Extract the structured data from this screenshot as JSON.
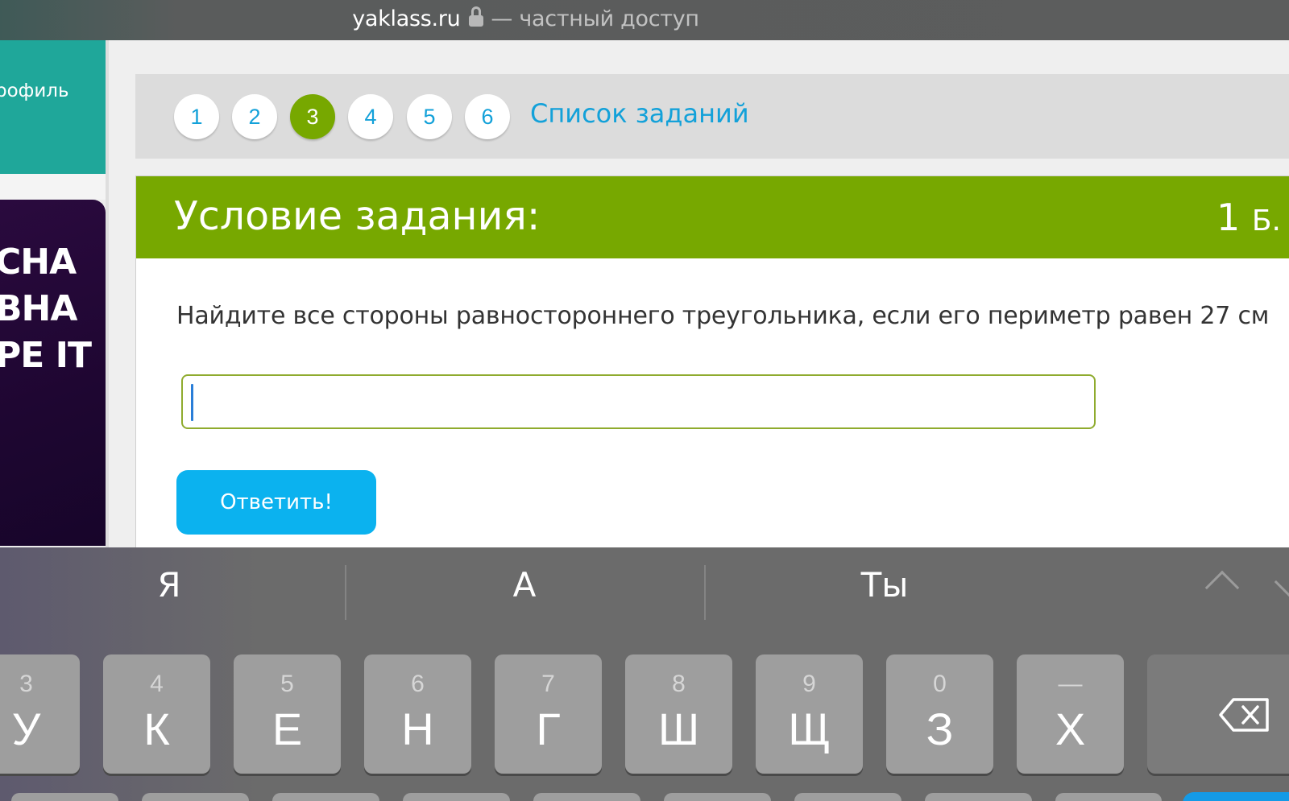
{
  "browser": {
    "domain": "yaklass.ru",
    "access_text": "— частный доступ"
  },
  "sidebar": {
    "profile_label": "рофиль",
    "promo_lines": [
      "СНА",
      "ВНА",
      "РЕ IT"
    ]
  },
  "task_nav": {
    "numbers": [
      "1",
      "2",
      "3",
      "4",
      "5",
      "6"
    ],
    "active_index": 2,
    "task_list_label": "Список заданий"
  },
  "task": {
    "header_title": "Условие задания:",
    "points_value": "1",
    "points_unit": "Б.",
    "question": "Найдите все стороны равностороннего треугольника, если его периметр равен 27 см",
    "answer_value": "",
    "submit_label": "Ответить!"
  },
  "keyboard": {
    "suggestions": [
      "Я",
      "А",
      "Ты"
    ],
    "keys": [
      {
        "num": "3",
        "letter": "У"
      },
      {
        "num": "4",
        "letter": "К"
      },
      {
        "num": "5",
        "letter": "Е"
      },
      {
        "num": "6",
        "letter": "Н"
      },
      {
        "num": "7",
        "letter": "Г"
      },
      {
        "num": "8",
        "letter": "Ш"
      },
      {
        "num": "9",
        "letter": "Щ"
      },
      {
        "num": "0",
        "letter": "З"
      },
      {
        "num": "—",
        "letter": "Х"
      }
    ]
  },
  "colors": {
    "brand_green": "#77a800",
    "link_blue": "#13a1d9",
    "button_blue": "#0bb2ef",
    "sidebar_teal": "#1fa79a"
  }
}
